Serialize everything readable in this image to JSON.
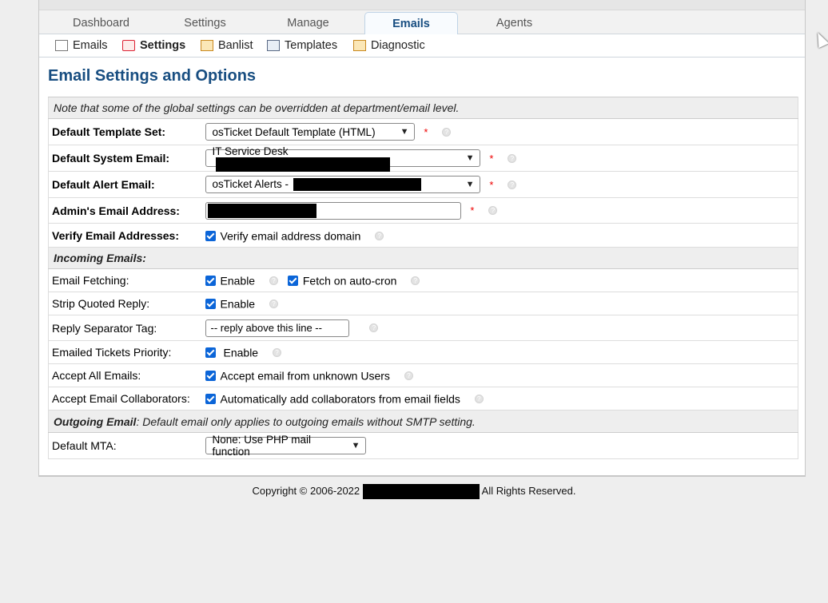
{
  "nav": {
    "tabs": [
      {
        "label": "Dashboard"
      },
      {
        "label": "Settings"
      },
      {
        "label": "Manage"
      },
      {
        "label": "Emails"
      },
      {
        "label": "Agents"
      }
    ],
    "active": "Emails"
  },
  "subnav": {
    "items": [
      {
        "label": "Emails",
        "icon": "mail-icon"
      },
      {
        "label": "Settings",
        "icon": "email-settings-icon"
      },
      {
        "label": "Banlist",
        "icon": "banlist-icon"
      },
      {
        "label": "Templates",
        "icon": "templates-icon"
      },
      {
        "label": "Diagnostic",
        "icon": "diagnostic-icon"
      }
    ],
    "active": "Settings"
  },
  "page_title": "Email Settings and Options",
  "note": "Note that some of the global settings can be overridden at department/email level.",
  "fields": {
    "default_template_set": {
      "label": "Default Template Set:",
      "value": "osTicket Default Template (HTML)"
    },
    "default_system_email": {
      "label": "Default System Email:",
      "value": "IT Service Desk"
    },
    "default_alert_email": {
      "label": "Default Alert Email:",
      "value": "osTicket Alerts -"
    },
    "admin_email": {
      "label": "Admin's Email Address:"
    },
    "verify_email": {
      "label": "Verify Email Addresses:",
      "checkbox": "Verify email address domain",
      "checked": true
    }
  },
  "incoming": {
    "header": "Incoming Emails:",
    "email_fetching": {
      "label": "Email Fetching:",
      "enable": "Enable",
      "auto_cron": "Fetch on auto-cron"
    },
    "strip_quoted": {
      "label": "Strip Quoted Reply:",
      "enable": "Enable"
    },
    "reply_separator": {
      "label": "Reply Separator Tag:",
      "value": "-- reply above this line --"
    },
    "priority": {
      "label": "Emailed Tickets Priority:",
      "enable": "Enable"
    },
    "accept_all": {
      "label": "Accept All Emails:",
      "checkbox": "Accept email from unknown Users"
    },
    "collaborators": {
      "label": "Accept Email Collaborators:",
      "checkbox": "Automatically add collaborators from email fields"
    }
  },
  "outgoing": {
    "header": "Outgoing Email",
    "header_note": ": Default email only applies to outgoing emails without SMTP setting.",
    "default_mta": {
      "label": "Default MTA:",
      "value": "None: Use PHP mail function"
    }
  },
  "footer": {
    "copyright": "Copyright © 2006-2022",
    "rights": "All Rights Reserved."
  },
  "required_mark": "*",
  "help_mark": "?"
}
